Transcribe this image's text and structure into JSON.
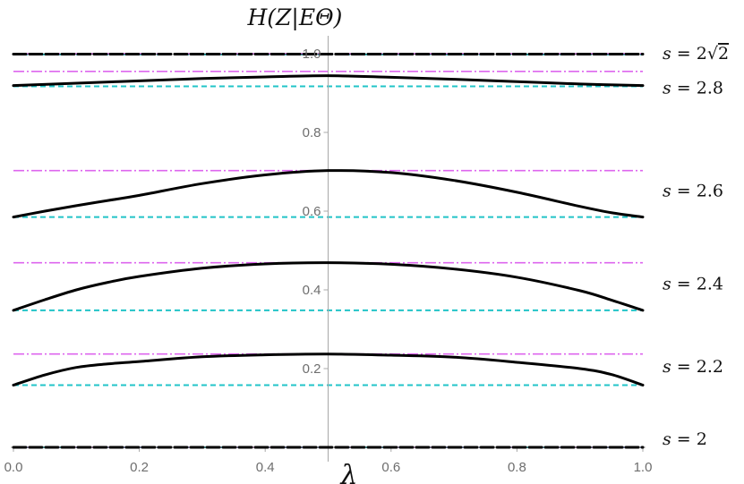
{
  "chart_data": {
    "type": "line",
    "title": "",
    "xlabel": "λ",
    "ylabel": "H(Z|EΘ)",
    "xlim": [
      0.0,
      1.0
    ],
    "ylim": [
      0.0,
      1.0
    ],
    "x_ticks": [
      "0.0",
      "0.2",
      "0.4",
      "0.6",
      "0.8",
      "1.0"
    ],
    "y_ticks": [
      "0.2",
      "0.4",
      "0.6",
      "0.8",
      "1.0"
    ],
    "grid": false,
    "colors": {
      "curve": "#000000",
      "upper_bound": "#dd66ee",
      "lower_bound": "#22c4c8",
      "axis": "#a8a8a8"
    },
    "series": [
      {
        "name": "s = 2",
        "label_prefix": "s = ",
        "label_value": "2",
        "curve": {
          "x": [
            0.0,
            0.5,
            1.0
          ],
          "y": [
            0.0,
            0.0,
            0.0
          ]
        },
        "upper_bound": 0.0,
        "lower_bound": 0.0
      },
      {
        "name": "s = 2.2",
        "label_prefix": "s = ",
        "label_value": "2.2",
        "curve": {
          "x": [
            0.0,
            0.05,
            0.1,
            0.15,
            0.2,
            0.3,
            0.4,
            0.5,
            0.6,
            0.7,
            0.8,
            0.9,
            0.95,
            1.0
          ],
          "y": [
            0.158,
            0.184,
            0.203,
            0.212,
            0.218,
            0.23,
            0.235,
            0.237,
            0.234,
            0.229,
            0.216,
            0.2,
            0.185,
            0.158
          ]
        },
        "upper_bound": 0.237,
        "lower_bound": 0.158
      },
      {
        "name": "s = 2.4",
        "label_prefix": "s = ",
        "label_value": "2.4",
        "curve": {
          "x": [
            0.0,
            0.05,
            0.1,
            0.15,
            0.2,
            0.3,
            0.4,
            0.5,
            0.6,
            0.7,
            0.8,
            0.9,
            0.95,
            1.0
          ],
          "y": [
            0.348,
            0.375,
            0.4,
            0.419,
            0.434,
            0.455,
            0.466,
            0.469,
            0.465,
            0.453,
            0.432,
            0.398,
            0.374,
            0.348
          ]
        },
        "upper_bound": 0.469,
        "lower_bound": 0.348
      },
      {
        "name": "s = 2.6",
        "label_prefix": "s = ",
        "label_value": "2.6",
        "curve": {
          "x": [
            0.0,
            0.05,
            0.1,
            0.15,
            0.2,
            0.3,
            0.4,
            0.5,
            0.6,
            0.7,
            0.8,
            0.9,
            0.95,
            1.0
          ],
          "y": [
            0.585,
            0.6,
            0.614,
            0.627,
            0.64,
            0.67,
            0.692,
            0.703,
            0.698,
            0.678,
            0.648,
            0.612,
            0.596,
            0.585
          ]
        },
        "upper_bound": 0.703,
        "lower_bound": 0.585
      },
      {
        "name": "s = 2.8",
        "label_prefix": "s = ",
        "label_value": "2.8",
        "curve": {
          "x": [
            0.0,
            0.1,
            0.2,
            0.3,
            0.4,
            0.5,
            0.6,
            0.7,
            0.8,
            0.9,
            1.0
          ],
          "y": [
            0.919,
            0.925,
            0.931,
            0.937,
            0.941,
            0.944,
            0.94,
            0.935,
            0.929,
            0.923,
            0.919
          ]
        },
        "upper_bound": 0.955,
        "lower_bound": 0.917
      },
      {
        "name": "s = 2√2",
        "label_prefix": "s = 2",
        "label_value": "2",
        "label_sqrt": true,
        "curve": {
          "x": [
            0.0,
            0.5,
            1.0
          ],
          "y": [
            0.999,
            0.999,
            0.999
          ]
        },
        "upper_bound": 1.0,
        "lower_bound": 0.998
      }
    ]
  }
}
